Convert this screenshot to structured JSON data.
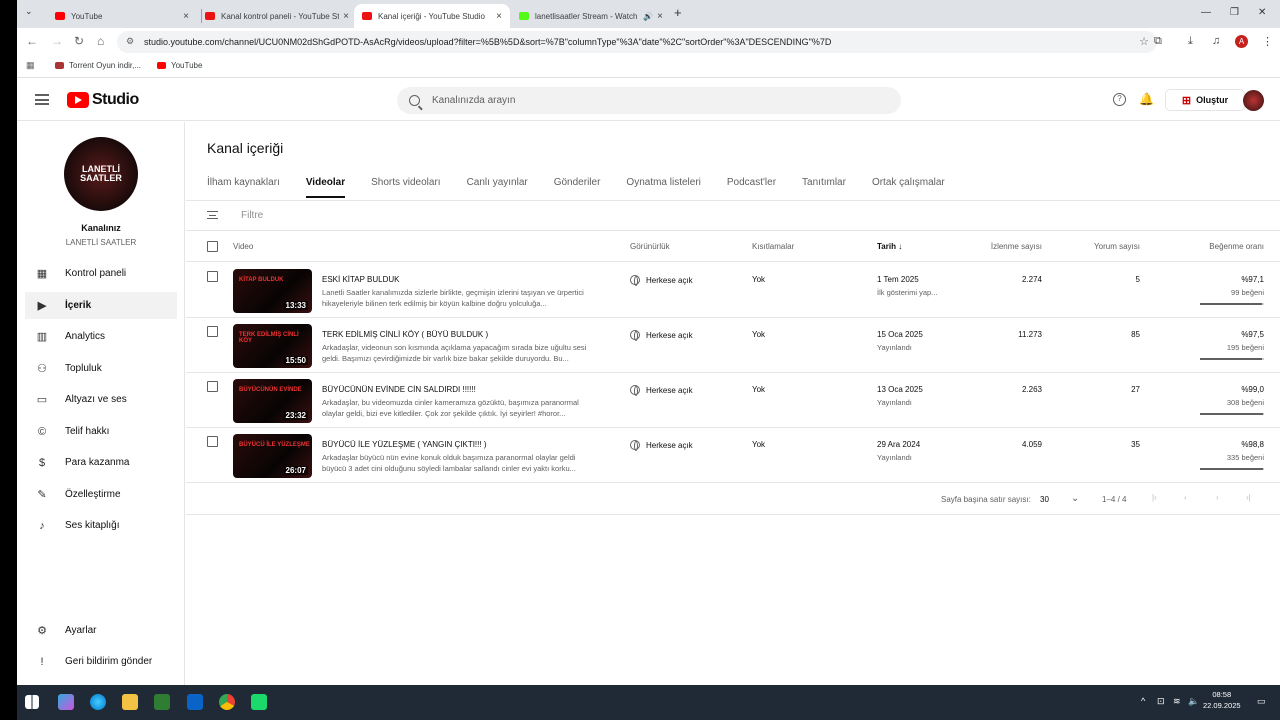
{
  "browser": {
    "tabs": [
      {
        "title": "YouTube",
        "close": "×"
      },
      {
        "title": "Kanal kontrol paneli - YouTube Studio",
        "close": "×"
      },
      {
        "title": "Kanal içeriği - YouTube Studio",
        "close": "×"
      },
      {
        "title": "lanetlisaatler Stream - Watch",
        "close": "×"
      }
    ],
    "new_tab": "+",
    "url": "studio.youtube.com/channel/UCU0NM02dShGdPOTD-AsAcRg/videos/upload?filter=%5B%5D&sort=%7B\"columnType\"%3A\"date\"%2C\"sortOrder\"%3A\"DESCENDING\"%7D",
    "profile_initial": "A",
    "bookmarks": [
      {
        "label": "Torrent Oyun indir,..."
      },
      {
        "label": "YouTube"
      }
    ]
  },
  "studio": {
    "logo_text": "Studio",
    "search_placeholder": "Kanalınızda arayın",
    "create_label": "Oluştur"
  },
  "sidebar": {
    "channel_title": "Kanalınız",
    "channel_name": "LANETLİ SAATLER",
    "avatar_text": "LANETLİ SAATLER",
    "items": [
      {
        "label": "Kontrol paneli",
        "icon": "dashboard-icon"
      },
      {
        "label": "İçerik",
        "icon": "content-icon"
      },
      {
        "label": "Analytics",
        "icon": "analytics-icon"
      },
      {
        "label": "Topluluk",
        "icon": "community-icon"
      },
      {
        "label": "Altyazı ve ses",
        "icon": "subtitles-icon"
      },
      {
        "label": "Telif hakkı",
        "icon": "copyright-icon"
      },
      {
        "label": "Para kazanma",
        "icon": "monetization-icon"
      },
      {
        "label": "Özelleştirme",
        "icon": "customization-icon"
      },
      {
        "label": "Ses kitaplığı",
        "icon": "audio-library-icon"
      }
    ],
    "bottom": [
      {
        "label": "Ayarlar",
        "icon": "settings-icon"
      },
      {
        "label": "Geri bildirim gönder",
        "icon": "feedback-icon"
      }
    ]
  },
  "main": {
    "title": "Kanal içeriği",
    "tabs": [
      "İlham kaynakları",
      "Videolar",
      "Shorts videoları",
      "Canlı yayınlar",
      "Gönderiler",
      "Oynatma listeleri",
      "Podcast'ler",
      "Tanıtımlar",
      "Ortak çalışmalar"
    ],
    "filter_label": "Filtre",
    "columns": {
      "video": "Video",
      "visibility": "Görünürlük",
      "restrictions": "Kısıtlamalar",
      "date": "Tarih",
      "views": "İzlenme sayısı",
      "comments": "Yorum sayısı",
      "likes": "Beğenme oranı"
    },
    "rows": [
      {
        "title": "ESKİ KİTAP BULDUK",
        "desc": "Lanetli Saatler kanalımızda sizlerle birlikte, geçmişin izlerini taşıyan ve ürpertici hikayeleriyle bilinen terk edilmiş bir köyün kalbine doğru yolculuğa...",
        "duration": "13:33",
        "thumb_text": "KİTAP BULDUK",
        "visibility": "Herkese açık",
        "restrictions": "Yok",
        "date": "1 Tem 2025",
        "status": "İlk gösterimi yap...",
        "views": "2.274",
        "comments": "5",
        "like_pct": "%97,1",
        "like_count": "99 beğeni",
        "like_ratio": 0.971
      },
      {
        "title": "TERK EDİLMİŞ CİNLİ KÖY ( BÜYÜ BULDUK )",
        "desc": "Arkadaşlar, videonun son kısmında açıklama yapacağım sırada bize uğultu sesi geldi. Başımızı çevirdiğimizde bir varlık bize bakar şekilde duruyordu. Bu...",
        "duration": "15:50",
        "thumb_text": "TERK EDİLMİŞ CİNLİ KÖY",
        "visibility": "Herkese açık",
        "restrictions": "Yok",
        "date": "15 Oca 2025",
        "status": "Yayınlandı",
        "views": "11.273",
        "comments": "85",
        "like_pct": "%97,5",
        "like_count": "195 beğeni",
        "like_ratio": 0.975
      },
      {
        "title": "BÜYÜCÜNÜN EVİNDE CİN SALDIRDI !!!!!!",
        "desc": "Arkadaşlar, bu videomuzda cinler kameramıza gözüktü, başımıza paranormal olaylar geldi, bizi eve kitlediler. Çok zor şekilde çıktık. İyi seyirler! #horor...",
        "duration": "23:32",
        "thumb_text": "BÜYÜCÜNÜN EVİNDE",
        "visibility": "Herkese açık",
        "restrictions": "Yok",
        "date": "13 Oca 2025",
        "status": "Yayınlandı",
        "views": "2.263",
        "comments": "27",
        "like_pct": "%99,0",
        "like_count": "308 beğeni",
        "like_ratio": 0.99
      },
      {
        "title": "BÜYÜCÜ İLE YÜZLEŞME ( YANGIN ÇIKTI!!! )",
        "desc": "Arkadaşlar büyücü nün evine konuk olduk başımıza paranormal olaylar geldi büyücü 3 adet cini olduğunu söyledi lambalar sallandı cinler evi yaktı korku...",
        "duration": "26:07",
        "thumb_text": "BÜYÜCÜ İLE YÜZLEŞME",
        "visibility": "Herkese açık",
        "restrictions": "Yok",
        "date": "29 Ara 2024",
        "status": "Yayınlandı",
        "views": "4.059",
        "comments": "35",
        "like_pct": "%98,8",
        "like_count": "335 beğeni",
        "like_ratio": 0.988
      }
    ],
    "pager": {
      "rows_per_page_label": "Sayfa başına satır sayısı:",
      "rows_per_page": "30",
      "range": "1–4 / 4"
    }
  },
  "taskbar": {
    "time": "08:58",
    "date": "22.09.2025"
  }
}
